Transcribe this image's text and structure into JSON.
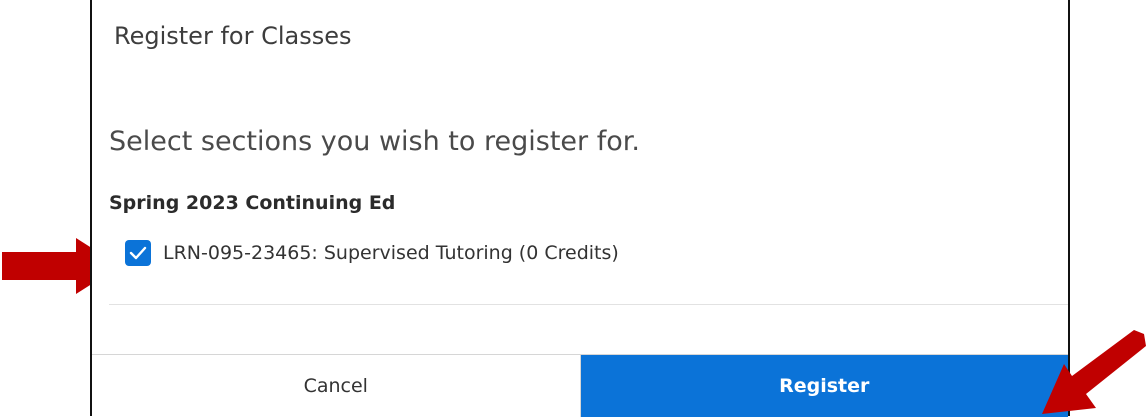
{
  "dialog": {
    "title": "Register for Classes",
    "instructions": "Select sections you wish to register for.",
    "term": "Spring 2023 Continuing Ed",
    "sections": [
      {
        "label": "LRN-095-23465: Supervised Tutoring (0 Credits)",
        "checked": true
      }
    ],
    "cancel_label": "Cancel",
    "register_label": "Register"
  },
  "colors": {
    "accent": "#0b73d8",
    "annotation_arrow": "#c00000"
  },
  "icons": {
    "checkbox": "checkmark-icon",
    "annotation": "red-arrow-icon"
  }
}
